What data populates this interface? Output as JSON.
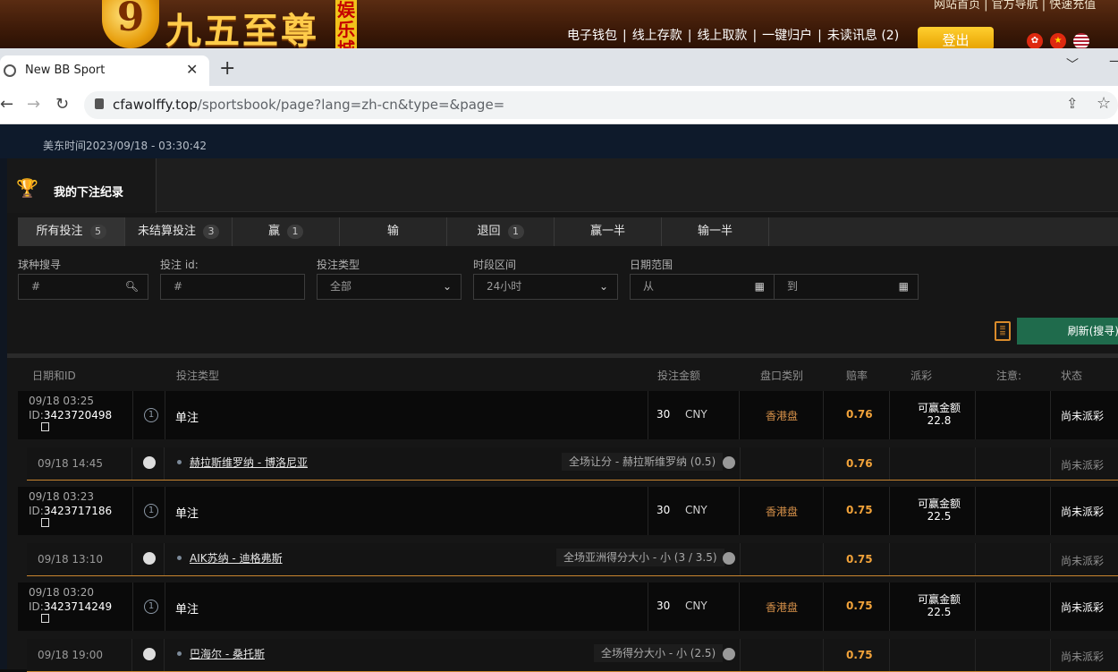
{
  "banner": {
    "logo_digit": "9",
    "logo_text": "九五至尊",
    "logo_vertical": "娱乐城",
    "small_links": "网站首页 | 官方导航 | 快速充值",
    "nav_links": [
      "电子钱包",
      "线上存款",
      "线上取款",
      "一键归户",
      "未读讯息 (2)"
    ],
    "logout_label": "登出"
  },
  "browser": {
    "tab_title": "New BB Sport",
    "url_host": "cfawolffy.top",
    "url_path": "/sportsbook/page?lang=zh-cn&type=&page="
  },
  "page": {
    "date_text": "美东时间2023/09/18 - 03:30:42",
    "panel_title": "我的下注纪录",
    "filter_tabs": [
      {
        "label": "所有投注",
        "count": "5"
      },
      {
        "label": "未结算投注",
        "count": "3"
      },
      {
        "label": "赢",
        "count": "1"
      },
      {
        "label": "输",
        "count": ""
      },
      {
        "label": "退回",
        "count": "1"
      },
      {
        "label": "赢一半",
        "count": ""
      },
      {
        "label": "输一半",
        "count": ""
      }
    ],
    "filters": {
      "sport_label": "球种搜寻",
      "sport_placeholder": "#",
      "betid_label": "投注 id:",
      "betid_placeholder": "#",
      "bettype_label": "投注类型",
      "bettype_value": "全部",
      "period_label": "时段区间",
      "period_value": "24小时",
      "daterange_label": "日期范围",
      "from_placeholder": "从",
      "to_placeholder": "到"
    },
    "refresh_label": "刷新(搜寻)",
    "headers": [
      "日期和ID",
      "投注类型",
      "投注金额",
      "盘口类别",
      "赔率",
      "派彩",
      "注意:",
      "状态"
    ],
    "bets": [
      {
        "datetime": "09/18 03:25",
        "id_prefix": "ID:",
        "id": "3423720498",
        "num": "1",
        "type": "单注",
        "amount": "30",
        "currency": "CNY",
        "market": "香港盘",
        "odds": "0.76",
        "win_label": "可赢金额",
        "win_amount": "22.8",
        "status": "尚未派彩",
        "event": {
          "time": "09/18 14:45",
          "match": "赫拉斯维罗纳 - 博洛尼亚",
          "selection": "全场让分 - 赫拉斯维罗纳 (0.5)",
          "odds": "0.76",
          "status": "尚未派彩"
        }
      },
      {
        "datetime": "09/18 03:23",
        "id_prefix": "ID:",
        "id": "3423717186",
        "num": "1",
        "type": "单注",
        "amount": "30",
        "currency": "CNY",
        "market": "香港盘",
        "odds": "0.75",
        "win_label": "可赢金额",
        "win_amount": "22.5",
        "status": "尚未派彩",
        "event": {
          "time": "09/18 13:10",
          "match": "AIK苏纳 - 迪格弗斯",
          "selection": "全场亚洲得分大小 - 小 (3 / 3.5)",
          "odds": "0.75",
          "status": "尚未派彩"
        }
      },
      {
        "datetime": "09/18 03:20",
        "id_prefix": "ID:",
        "id": "3423714249",
        "num": "1",
        "type": "单注",
        "amount": "30",
        "currency": "CNY",
        "market": "香港盘",
        "odds": "0.75",
        "win_label": "可赢金额",
        "win_amount": "22.5",
        "status": "尚未派彩",
        "event": {
          "time": "09/18 19:00",
          "match": "巴海尔 - 桑托斯",
          "selection": "全场得分大小 - 小 (2.5)",
          "odds": "0.75",
          "status": "尚未派彩"
        }
      }
    ]
  }
}
